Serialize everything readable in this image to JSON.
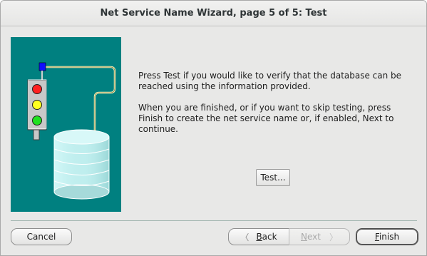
{
  "window": {
    "title": "Net Service Name Wizard, page 5 of 5: Test"
  },
  "instructions": {
    "paragraph1": "Press Test if you would like to verify that the database can be reached using the information provided.",
    "paragraph2": "When you are finished, or if you want to skip testing, press Finish to create the net service name or, if enabled, Next to continue."
  },
  "buttons": {
    "test": "Test...",
    "cancel": "Cancel",
    "back": {
      "mnemonic": "B",
      "rest": "ack"
    },
    "next": {
      "mnemonic": "N",
      "rest": "ext"
    },
    "finish": {
      "mnemonic": "F",
      "rest": "inish"
    }
  },
  "icons": {
    "back_arrow": "chevron-left-icon",
    "next_arrow": "chevron-right-icon"
  },
  "colors": {
    "panel_background": "#008080",
    "light_red": "#ff2020",
    "light_yellow": "#ffff20",
    "light_green": "#20e020",
    "plug": "#1010ff"
  }
}
